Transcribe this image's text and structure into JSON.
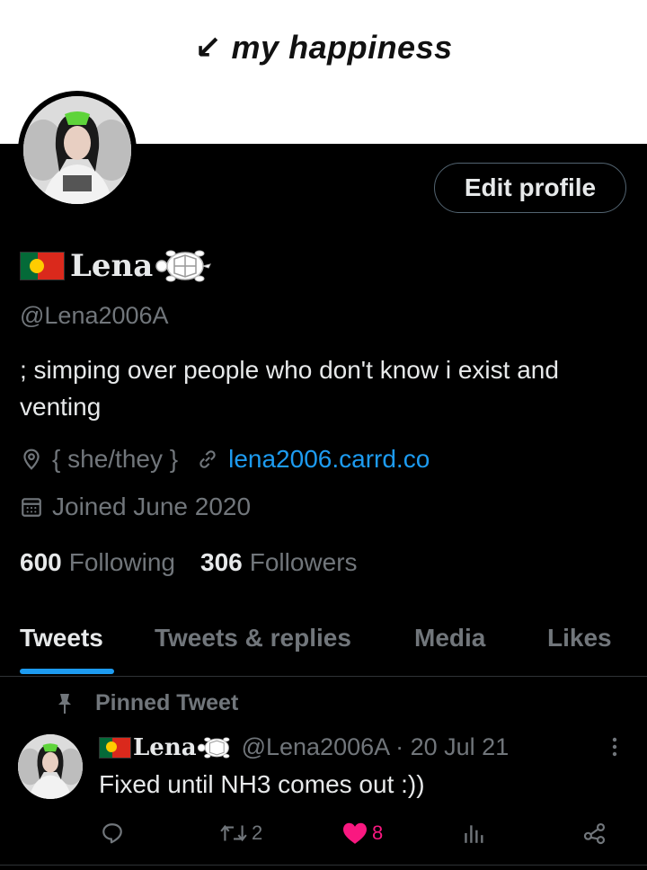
{
  "banner": {
    "text": "↙ my happiness"
  },
  "profile": {
    "edit_button": "Edit profile",
    "display_name": "Lena",
    "handle": "@Lena2006A",
    "bio": "; simping over people who don't know i exist and venting",
    "location": "{ she/they }",
    "website": "lena2006.carrd.co",
    "joined": "Joined June 2020",
    "following_count": "600",
    "following_label": "Following",
    "followers_count": "306",
    "followers_label": "Followers"
  },
  "tabs": [
    {
      "label": "Tweets",
      "active": true
    },
    {
      "label": "Tweets & replies",
      "active": false
    },
    {
      "label": "Media",
      "active": false
    },
    {
      "label": "Likes",
      "active": false
    }
  ],
  "pinned_tweet": {
    "label": "Pinned Tweet",
    "author_name": "Lena",
    "handle_date": "@Lena2006A · 20 Jul 21",
    "text": "Fixed until NH3 comes out :))",
    "retweets": "2",
    "likes": "8"
  },
  "colors": {
    "accent": "#1d9bf0",
    "like": "#f91880",
    "muted": "#71767b",
    "background": "#000000"
  },
  "icons": [
    "location-icon",
    "link-icon",
    "calendar-icon",
    "pin-icon",
    "more-icon",
    "reply-icon",
    "retweet-icon",
    "heart-icon",
    "analytics-icon",
    "share-icon",
    "turtle-emoji",
    "portugal-flag"
  ]
}
